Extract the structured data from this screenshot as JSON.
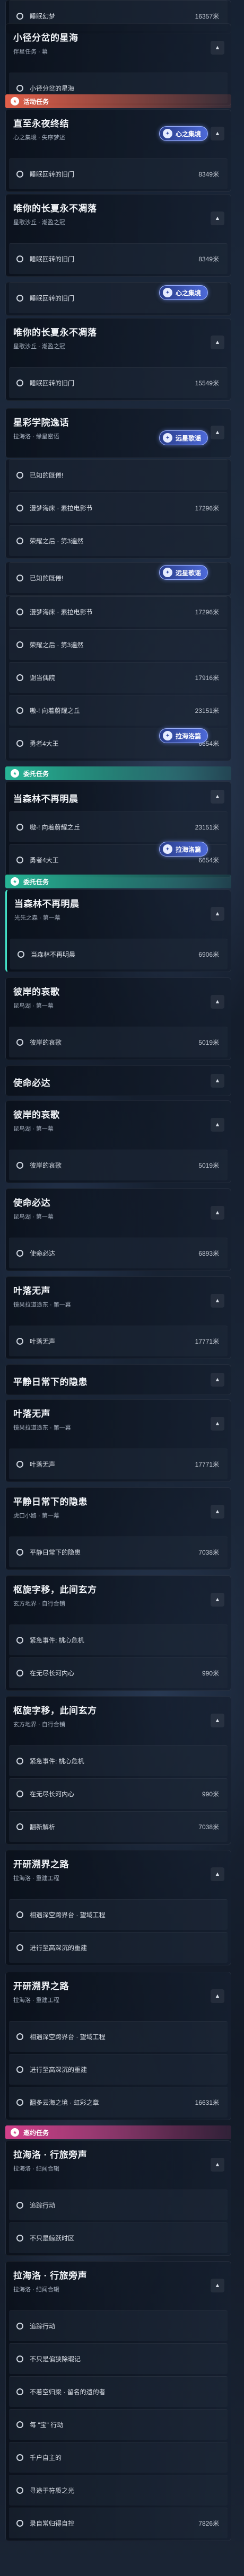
{
  "top": {
    "step": "睡眠幻梦",
    "dist": "16357米"
  },
  "q1": {
    "title": "小径分岔的星海",
    "sub": "伴星任务 · 幕",
    "step": "小径分岔的星海"
  },
  "sections": {
    "event": "活动任务",
    "commission": "委托任务",
    "bond": "邀约任务"
  },
  "q2": {
    "title": "直至永夜终结",
    "sub": "心之集境 · 失序梦述",
    "step": "睡眠回转的旧门",
    "dist": "8349米"
  },
  "q3": {
    "title": "唯你的长夏永不凋落",
    "sub": "星歌沙丘 · 潮盈之冠"
  },
  "q3b": {
    "title": "唯你的长夏永不凋落",
    "sub": "星歌沙丘 · 潮盈之冠",
    "step": "睡眠回转的旧门",
    "dist": "15549米"
  },
  "q4": {
    "title": "星彩学院逸话",
    "sub": "拉海洛 · 缘星密语"
  },
  "steps": {
    "s1": "睡眠回转的旧门",
    "s2": "已知的既倦!",
    "s3": "漫梦海床 · 素拉电影节",
    "s4": "荣耀之后 · 第3遍然",
    "s5": "漫梦海床 · 素拉电影节",
    "s6": "荣耀之后 · 第3遍然",
    "s7": "谢当偶院",
    "s8": "嗷-! 向着蔚耀之丘",
    "s9": "勇者4大王",
    "s10": "嗷-! 向着蔚耀之丘",
    "s11": "勇者4大王",
    "s12": "当森林不再明晨",
    "s13": "彼岸的哀歌",
    "s14": "彼岸的哀歌",
    "s15": "使命必达",
    "s16": "叶落无声",
    "s17": "平静日常下的隐患",
    "s18": "紧急事件: 桃心危机",
    "s19": "在无尽长河内心",
    "s20": "紧急事件: 桃心危机",
    "s21": "在无尽长河内心",
    "s22": "翻新解析",
    "s23": "相遇深空跨界台 · 望域工程",
    "s24": "进行至高深沉的重建",
    "s25": "相遇深空跨界台 · 望域工程",
    "s26": "进行至高深沉的重建",
    "s27": "翻多云海之境 · 虹彩之章",
    "s28": "追踪行动",
    "s29": "不只是鲸跃时区",
    "s30": "追踪行动",
    "s31": "不只是偏狭除瑕记",
    "s32": "不着空归梁 · 留名的遗的者",
    "s33": "每 \"宝\" 行动",
    "s34": "千户自主的",
    "s35": "寻途于符质之光",
    "s36": "录自常归得自控"
  },
  "dists": {
    "d1": "8349米",
    "d2": "17296米",
    "d3": "17296米",
    "d4": "17916米",
    "d5": "23151米",
    "d6": "6654米",
    "d7": "23151米",
    "d8": "6654米",
    "d9": "6906米",
    "d10": "5019米",
    "d11": "5019米",
    "d12": "6893米",
    "d13": "17771米",
    "d14": "17771米",
    "d15": "7038米",
    "d16": "990米",
    "d17": "990米",
    "d18": "7038米",
    "d19": "16631米",
    "d20": "7826米"
  },
  "q5": {
    "title": "当森林不再明晨",
    "sub": "光先之森 · 第一幕"
  },
  "q5b": {
    "title": "当森林不再明晨",
    "sub": "光先之森 · 第一幕"
  },
  "q6": {
    "title": "彼岸的哀歌",
    "sub": "昆鸟湖 · 第一幕"
  },
  "q6b": {
    "title": "彼岸的哀歌",
    "sub": "昆鸟湖 · 第一幕"
  },
  "q7": {
    "title": "使命必达"
  },
  "q7b": {
    "title": "使命必达",
    "sub": "昆鸟湖 · 第一幕"
  },
  "q8": {
    "title": "叶落无声",
    "sub": "镜果拉道途东 · 第一幕"
  },
  "q8b": {
    "title": "叶落无声",
    "sub": "镜果拉道途东 · 第一幕"
  },
  "q9": {
    "title": "平静日常下的隐患"
  },
  "q9b": {
    "title": "平静日常下的隐患",
    "sub": "虎口小路 · 第一幕"
  },
  "q10": {
    "title": "枢旋字移，此间玄方",
    "sub": "玄方地界 · 自行合销"
  },
  "q10b": {
    "title": "枢旋字移，此间玄方",
    "sub": "玄方地界 · 自行合销"
  },
  "q11": {
    "title": "开研溯界之路",
    "sub": "拉海洛 · 重建工程"
  },
  "q11b": {
    "title": "开研溯界之路",
    "sub": "拉海洛 · 重建工程"
  },
  "q12": {
    "title": "拉海洛 · 行旅旁声",
    "sub": "拉海洛 · 纪闻合辑"
  },
  "q12b": {
    "title": "拉海洛 · 行旅旁声",
    "sub": "拉海洛 · 纪闻合辑"
  },
  "tags": {
    "t1": "心之集境",
    "t2": "心之集境",
    "t3": "远星歌谣",
    "t4": "远星歌谣",
    "t5": "拉海洛篇",
    "t6": "拉海洛篇"
  },
  "icons": {
    "section": "star-icon",
    "caret": "chevron-up-icon",
    "bullet": "circle-icon",
    "tag": "sparkle-icon"
  }
}
